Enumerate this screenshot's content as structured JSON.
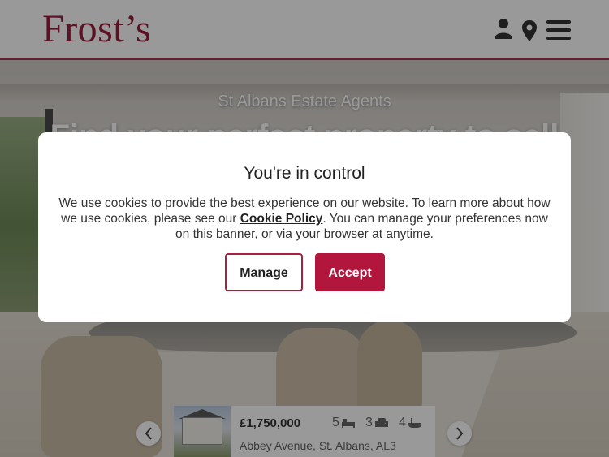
{
  "header": {
    "logo_text": "Frost’s",
    "icons": [
      "person-icon",
      "location-pin-icon",
      "hamburger-menu-icon"
    ],
    "brand_color": "#9a1f3c"
  },
  "hero": {
    "subtitle": "St Albans Estate Agents",
    "title": "Find your perfect property to sell"
  },
  "property": {
    "price": "£1,750,000",
    "bedrooms": "5",
    "receptions": "3",
    "bathrooms": "4",
    "address": "Abbey Avenue, St. Albans, AL3",
    "feature_icons": [
      "bed-icon",
      "armchair-icon",
      "bath-icon"
    ]
  },
  "cookie_banner": {
    "title": "You're in control",
    "text_before_link": "We use cookies to provide the best experience on our website. To learn more about how we use cookies, please see our ",
    "link_text": "Cookie Policy",
    "text_after_link": ". You can manage your preferences now on this banner, or via your browser at anytime.",
    "manage_label": "Manage",
    "accept_label": "Accept",
    "accent_color": "#b3163c"
  }
}
